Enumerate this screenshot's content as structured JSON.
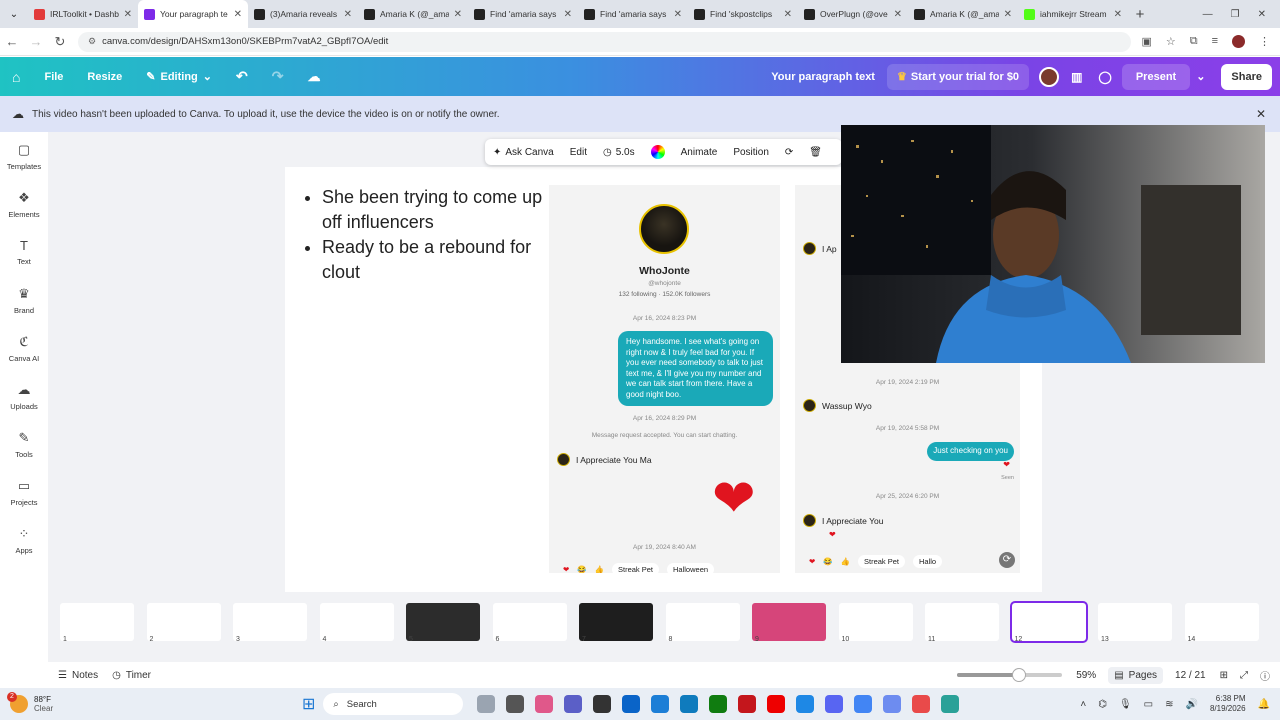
{
  "browser": {
    "tabs": [
      {
        "title": "IRLToolkit • Dashb",
        "color": "#e23b3b",
        "active": false
      },
      {
        "title": "Your paragraph te",
        "color": "#7d2ae8",
        "active": true
      },
      {
        "title": "(3)Amaria reveals",
        "color": "#222222",
        "active": false
      },
      {
        "title": "Amaria K (@_ama",
        "color": "#222222",
        "active": false
      },
      {
        "title": "Find 'amaria says",
        "color": "#222222",
        "active": false
      },
      {
        "title": "Find 'amaria says",
        "color": "#222222",
        "active": false
      },
      {
        "title": "Find 'skpostclips",
        "color": "#222222",
        "active": false
      },
      {
        "title": "OverPlugn (@ove",
        "color": "#222222",
        "active": false
      },
      {
        "title": "Amaria K (@_ama",
        "color": "#222222",
        "active": false
      },
      {
        "title": "iahmikejrr Stream",
        "color": "#53fc18",
        "active": false
      }
    ],
    "url": "canva.com/design/DAHSxm13on0/SKEBPrm7vatA2_GBpfI7OA/edit"
  },
  "canva": {
    "file": "File",
    "resize": "Resize",
    "editing": "Editing",
    "doc_title": "Your paragraph text",
    "trial": "Start your trial for $0",
    "present": "Present",
    "share": "Share"
  },
  "notice": "This video hasn't been uploaded to Canva. To upload it, use the device the video is on or notify the owner.",
  "sidebar": [
    {
      "label": "Templates",
      "icon": "template-icon",
      "glyph": "▢"
    },
    {
      "label": "Elements",
      "icon": "elements-icon",
      "glyph": "❖"
    },
    {
      "label": "Text",
      "icon": "text-icon",
      "glyph": "T"
    },
    {
      "label": "Brand",
      "icon": "brand-icon",
      "glyph": "♛"
    },
    {
      "label": "Canva AI",
      "icon": "canva-ai-icon",
      "glyph": "ℭ"
    },
    {
      "label": "Uploads",
      "icon": "upload-icon",
      "glyph": "☁"
    },
    {
      "label": "Tools",
      "icon": "tools-icon",
      "glyph": "✎"
    },
    {
      "label": "Projects",
      "icon": "folder-icon",
      "glyph": "▭"
    },
    {
      "label": "Apps",
      "icon": "apps-icon",
      "glyph": "⁘"
    }
  ],
  "context_toolbar": {
    "ask": "Ask Canva",
    "edit": "Edit",
    "duration": "5.0s",
    "animate": "Animate",
    "position": "Position"
  },
  "slide": {
    "bullets": [
      "She been trying to come up off influencers",
      "Ready to be a rebound for clout"
    ]
  },
  "dm1": {
    "name": "WhoJonte",
    "handle": "@whojonte",
    "stats": "132 following · 152.0K followers",
    "date1": "Apr 16, 2024 8:23 PM",
    "message": "Hey handsome. I see what's going on right now & I truly feel bad for you. If you ever need somebody to talk to just text me, & I'll give you my number and we can talk start from there. Have a good night boo.",
    "date2": "Apr 16, 2024 8:29 PM",
    "accepted": "Message request accepted. You can start chatting.",
    "reply": "I Appreciate You Ma",
    "date3": "Apr 19, 2024 8:40 AM",
    "reactions": [
      "Streak Pet",
      "Halloween"
    ]
  },
  "dm2": {
    "top_text": "I Ap",
    "date1": "Apr 19, 2024 2:19 PM",
    "msg1": "Wassup Wyo",
    "date2": "Apr 19, 2024 5:58 PM",
    "bubble": "Just checking on you",
    "seen": "Seen",
    "date3": "Apr 25, 2024 6:20 PM",
    "msg2": "I Appreciate You",
    "reactions": [
      "Streak Pet",
      "Hallo"
    ]
  },
  "thumbnails": [
    "1",
    "2",
    "3",
    "4",
    "5",
    "6",
    "7",
    "8",
    "9",
    "10",
    "11",
    "12",
    "13",
    "14"
  ],
  "bottom": {
    "notes": "Notes",
    "timer": "Timer",
    "zoom": "59%",
    "pages": "Pages",
    "page_count": "12 / 21",
    "zoom_level": 0.59
  },
  "taskbar": {
    "weather_temp": "88°F",
    "weather_desc": "Clear",
    "search": "Search",
    "time": "6:38 PM",
    "date": "8/19/2026",
    "badge": "2"
  }
}
